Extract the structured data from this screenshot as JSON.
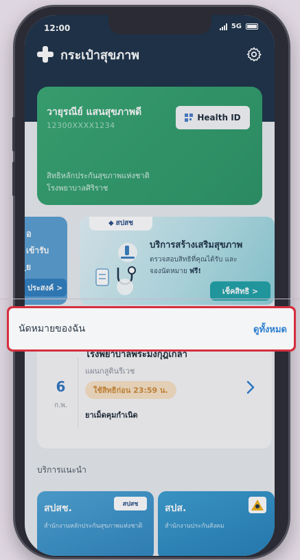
{
  "status_bar": {
    "time": "12:00",
    "network": "5G"
  },
  "header": {
    "app_title": "กระเป๋าสุขภาพ"
  },
  "health_card": {
    "name": "วายุรณีย์ แสนสุขภาพดี",
    "id_number": "12300XXXX1234",
    "button_label": "Health ID",
    "right_label": "สิทธิหลักประกันสุขภาพแห่งชาติ",
    "hospital": "โรงพยาบาลศิริราช"
  },
  "promo_left": {
    "line1": "อ",
    "line2": "เข้ารับ",
    "line3": "ฺย",
    "button": "ประสงค์ >"
  },
  "promo_main": {
    "logo": "สปสช",
    "title": "บริการสร้างเสริมสุขภาพ",
    "line1": "ตรวจสอบสิทธิที่คุณได้รับ และ",
    "line2_prefix": "จองนัดหมาย ",
    "line2_bold": "ฟรี!",
    "check_button": "เช็คสิทธิ >"
  },
  "appointments": {
    "section_title": "นัดหมายของฉัน",
    "view_all": "ดูทั้งหมด",
    "item": {
      "day": "6",
      "month": "ก.พ.",
      "hospital": "โรงพยาบาลพระมงกุฎเกล้า",
      "department": "แผนกสูตินรีเวช",
      "badge": "ใช้สิทธิก่อน 23:59 น.",
      "medicine": "ยาเม็ดคุมกำเนิด"
    }
  },
  "recommended": {
    "title": "บริการแนะนำ",
    "cards": [
      {
        "name": "สปสช.",
        "logo": "สปสช",
        "desc": "สำนักงานหลักประกันสุขภาพแห่งชาติ"
      },
      {
        "name": "สปส.",
        "logo": "",
        "desc": "สำนักงานประกันสังคม"
      }
    ]
  },
  "colors": {
    "header": "#1d3348",
    "card_green": "#38a873",
    "accent_blue": "#2d7fd0",
    "highlight_red": "#d62e3e"
  }
}
